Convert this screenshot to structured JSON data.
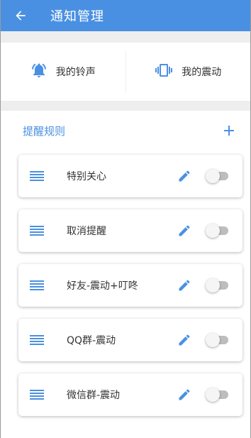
{
  "appbar": {
    "title": "通知管理",
    "color": "#4a90e2"
  },
  "tones": [
    {
      "label": "我的铃声",
      "icon": "bell-ring-icon"
    },
    {
      "label": "我的震动",
      "icon": "vibrate-icon"
    }
  ],
  "rules": {
    "title": "提醒规则",
    "add_icon": "plus-icon",
    "items": [
      {
        "label": "特别关心",
        "enabled": false
      },
      {
        "label": "取消提醒",
        "enabled": false
      },
      {
        "label": "好友-震动+叮咚",
        "enabled": false
      },
      {
        "label": "QQ群-震动",
        "enabled": false
      },
      {
        "label": "微信群-震动",
        "enabled": false
      }
    ]
  }
}
